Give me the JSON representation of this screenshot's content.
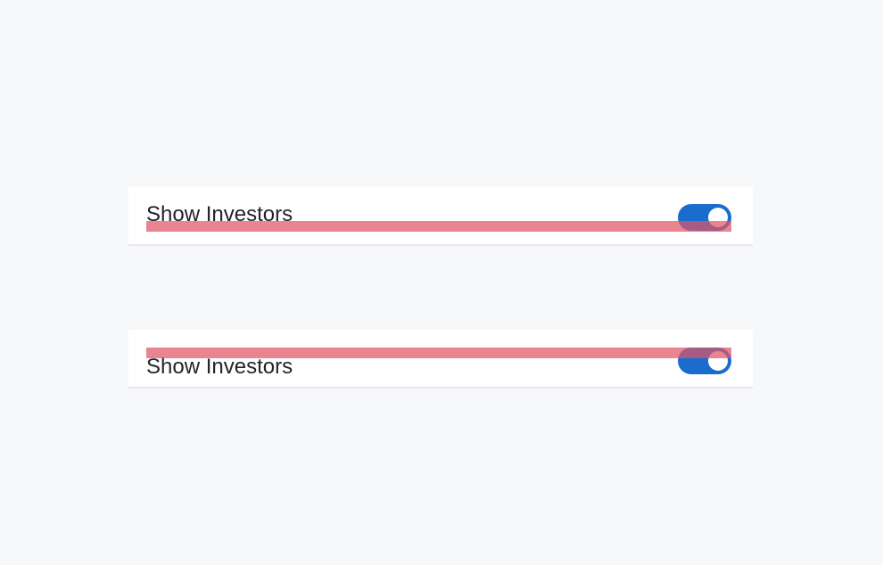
{
  "panels": [
    {
      "label": "Show Investors",
      "toggle_on": true
    },
    {
      "label": "Show Investors",
      "toggle_on": true
    }
  ],
  "colors": {
    "background": "#f7f8fa",
    "card": "#ffffff",
    "toggle_on": "#1a6dcc",
    "overlay": "#e05667"
  }
}
